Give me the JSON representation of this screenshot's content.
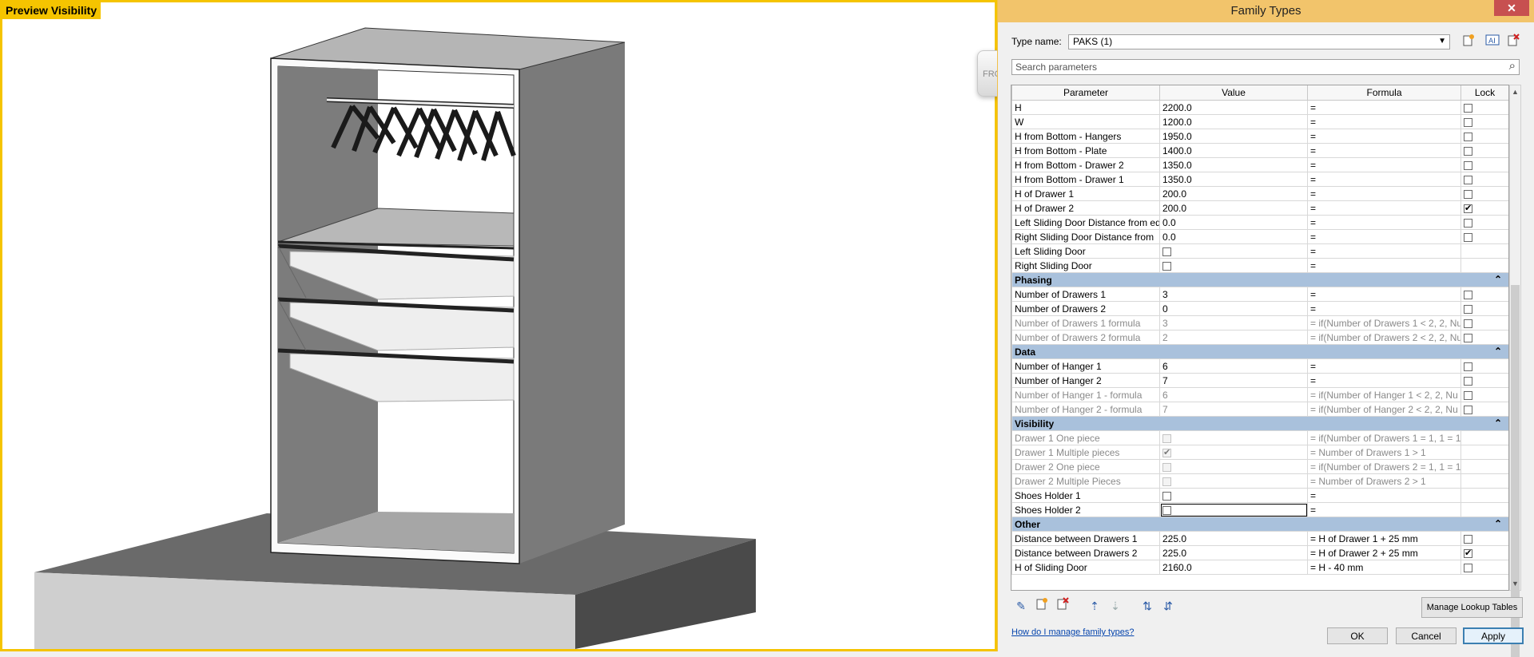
{
  "preview": {
    "label": "Preview Visibility",
    "view_cube_text": "FRO"
  },
  "dialog": {
    "title": "Family Types",
    "close": "✕",
    "type_name_label": "Type name:",
    "type_name_value": "PAKS (1)",
    "search_placeholder": "Search parameters",
    "columns": [
      "Parameter",
      "Value",
      "Formula",
      "Lock"
    ],
    "rows": [
      {
        "kind": "param",
        "name": "H",
        "value": "2200.0",
        "formula": "=",
        "lock": "unchecked"
      },
      {
        "kind": "param",
        "name": "W",
        "value": "1200.0",
        "formula": "=",
        "lock": "unchecked"
      },
      {
        "kind": "param",
        "name": "H from Bottom - Hangers",
        "value": "1950.0",
        "formula": "=",
        "lock": "unchecked"
      },
      {
        "kind": "param",
        "name": "H from Bottom - Plate",
        "value": "1400.0",
        "formula": "=",
        "lock": "unchecked"
      },
      {
        "kind": "param",
        "name": "H from Bottom - Drawer 2",
        "value": "1350.0",
        "formula": "=",
        "lock": "unchecked"
      },
      {
        "kind": "param",
        "name": "H from Bottom - Drawer 1",
        "value": "1350.0",
        "formula": "=",
        "lock": "unchecked"
      },
      {
        "kind": "param",
        "name": "H of Drawer 1",
        "value": "200.0",
        "formula": "=",
        "lock": "unchecked"
      },
      {
        "kind": "param",
        "name": "H of Drawer 2",
        "value": "200.0",
        "formula": "=",
        "lock": "checked"
      },
      {
        "kind": "param",
        "name": "Left Sliding Door Distance from ed",
        "value": "0.0",
        "formula": "=",
        "lock": "unchecked"
      },
      {
        "kind": "param",
        "name": "Right Sliding Door Distance from",
        "value": "0.0",
        "formula": "=",
        "lock": "unchecked"
      },
      {
        "kind": "param",
        "name": "Left Sliding Door",
        "value_check": "unchecked",
        "formula": "=",
        "lock": "none"
      },
      {
        "kind": "param",
        "name": "Right Sliding Door",
        "value_check": "unchecked",
        "formula": "=",
        "lock": "none"
      },
      {
        "kind": "group",
        "name": "Phasing"
      },
      {
        "kind": "param",
        "name": "Number of Drawers 1",
        "value": "3",
        "formula": "=",
        "lock": "unchecked"
      },
      {
        "kind": "param",
        "name": "Number of Drawers 2",
        "value": "0",
        "formula": "=",
        "lock": "unchecked"
      },
      {
        "kind": "param",
        "dim": true,
        "name": "Number of Drawers 1 formula",
        "value": "3",
        "formula": "= if(Number of Drawers 1 < 2, 2, Nu",
        "lock": "unchecked"
      },
      {
        "kind": "param",
        "dim": true,
        "name": "Number of Drawers 2 formula",
        "value": "2",
        "formula": "= if(Number of Drawers 2 < 2, 2, Nu",
        "lock": "unchecked"
      },
      {
        "kind": "group",
        "name": "Data"
      },
      {
        "kind": "param",
        "name": "Number of Hanger 1",
        "value": "6",
        "formula": "=",
        "lock": "unchecked"
      },
      {
        "kind": "param",
        "name": "Number of Hanger 2",
        "value": "7",
        "formula": "=",
        "lock": "unchecked"
      },
      {
        "kind": "param",
        "dim": true,
        "name": "Number of Hanger 1 - formula",
        "value": "6",
        "formula": "= if(Number of Hanger 1 < 2, 2, Nu",
        "lock": "unchecked"
      },
      {
        "kind": "param",
        "dim": true,
        "name": "Number of Hanger 2 - formula",
        "value": "7",
        "formula": "= if(Number of Hanger 2 < 2, 2, Nu",
        "lock": "unchecked"
      },
      {
        "kind": "group",
        "name": "Visibility"
      },
      {
        "kind": "param",
        "dim": true,
        "name": "Drawer 1 One piece",
        "value_check": "disabled",
        "formula": "= if(Number of Drawers 1 = 1, 1 = 1,",
        "lock": "none"
      },
      {
        "kind": "param",
        "dim": true,
        "name": "Drawer 1 Multiple pieces",
        "value_check": "disabled-checked",
        "formula": "= Number of Drawers 1 > 1",
        "lock": "none"
      },
      {
        "kind": "param",
        "dim": true,
        "name": "Drawer 2 One piece",
        "value_check": "disabled",
        "formula": "= if(Number of Drawers 2 = 1, 1 = 1,",
        "lock": "none"
      },
      {
        "kind": "param",
        "dim": true,
        "name": "Drawer 2 Multiple Pieces",
        "value_check": "disabled",
        "formula": "= Number of Drawers 2 > 1",
        "lock": "none"
      },
      {
        "kind": "param",
        "name": "Shoes Holder 1",
        "value_check": "unchecked",
        "formula": "=",
        "lock": "none"
      },
      {
        "kind": "param",
        "name": "Shoes Holder 2",
        "value_check": "unchecked",
        "focused": true,
        "formula": "=",
        "lock": "none"
      },
      {
        "kind": "group",
        "name": "Other"
      },
      {
        "kind": "param",
        "name": "Distance between Drawers 1",
        "value": "225.0",
        "formula": "= H of Drawer 1 + 25 mm",
        "lock": "unchecked"
      },
      {
        "kind": "param",
        "name": "Distance between Drawers 2",
        "value": "225.0",
        "formula": "= H of Drawer 2 + 25 mm",
        "lock": "checked"
      },
      {
        "kind": "param",
        "name": "H of Sliding Door",
        "value": "2160.0",
        "formula": "= H - 40 mm",
        "lock": "unchecked"
      }
    ],
    "group_chevron": "⌃",
    "manage_lookup": "Manage Lookup Tables",
    "help_link": "How do I manage family types?",
    "ok": "OK",
    "cancel": "Cancel",
    "apply": "Apply"
  }
}
